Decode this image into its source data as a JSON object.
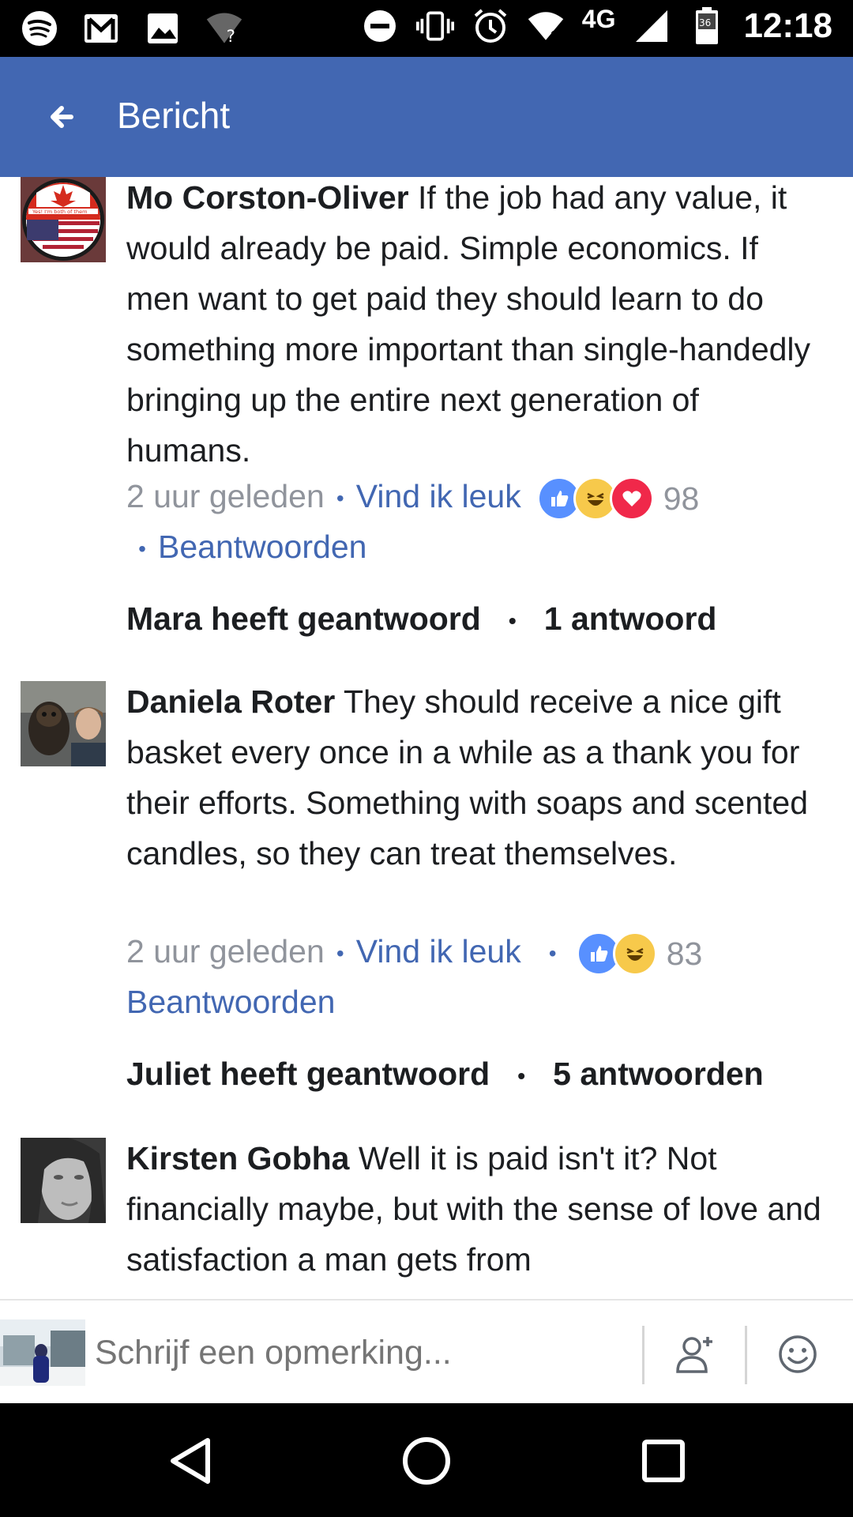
{
  "status_bar": {
    "network": "4G",
    "battery": "36",
    "time": "12:18"
  },
  "header": {
    "title": "Bericht"
  },
  "comments": [
    {
      "author": "Mo Corston-Oliver",
      "text": " If the job had any value, it would already be paid. Simple economics. If men want to get paid they should learn to do something more important than single-handedly bringing up the entire next generation of humans.",
      "avatar_badge_text": "Yes! I'm both of them",
      "time": "2 uur geleden",
      "like_label": "Vind ik leuk",
      "reaction_count": "98",
      "reply_label": "Beantwoorden",
      "replied_by": "Mara heeft geantwoord",
      "replies_count": "1 antwoord"
    },
    {
      "author": "Daniela Roter",
      "text": " They should receive a nice gift basket every once in a while as a thank you for their efforts. Something with soaps and scented candles, so they can treat themselves.",
      "time": "2 uur geleden",
      "like_label": "Vind ik leuk",
      "reaction_count": "83",
      "reply_label": "Beantwoorden",
      "replied_by": "Juliet heeft geantwoord",
      "replies_count": "5 antwoorden"
    },
    {
      "author": "Kirsten Gobha",
      "text": " Well it is paid isn't it? Not financially maybe, but with the sense of love and satisfaction a man gets from"
    }
  ],
  "composer": {
    "placeholder": "Schrijf een opmerking..."
  },
  "colors": {
    "facebook_blue": "#4267b2",
    "like_blue": "#5890ff",
    "haha_yellow": "#f7c94b",
    "love_red": "#f0284a",
    "meta_gray": "#90949c"
  }
}
